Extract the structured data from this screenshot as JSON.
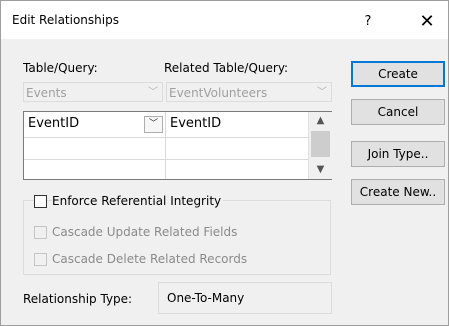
{
  "window": {
    "title": "Edit Relationships",
    "help_glyph": "?",
    "close_glyph": "✕"
  },
  "labels": {
    "table_query": "Table/Query:",
    "related_table_query": "Related Table/Query:"
  },
  "combos": {
    "table": "Events",
    "related_table": "EventVolunteers",
    "arrow_icon": "chevron-down-icon"
  },
  "grid": {
    "rows": [
      {
        "left": "EventID",
        "right": "EventID"
      },
      {
        "left": "",
        "right": ""
      },
      {
        "left": "",
        "right": ""
      }
    ]
  },
  "glyphs": {
    "chevron_down": "﹀",
    "scroll_up": "▲",
    "scroll_down": "▼"
  },
  "buttons": {
    "create": "Create",
    "cancel": "Cancel",
    "join_type": "Join Type..",
    "create_new": "Create New.."
  },
  "checkboxes": {
    "enforce": {
      "label": "Enforce Referential Integrity",
      "checked": false,
      "enabled": true
    },
    "cascade_update": {
      "label": "Cascade Update Related Fields",
      "checked": false,
      "enabled": false
    },
    "cascade_delete": {
      "label": "Cascade Delete Related Records",
      "checked": false,
      "enabled": false
    }
  },
  "relationship": {
    "label": "Relationship Type:",
    "value": "One-To-Many"
  },
  "colors": {
    "default_button_border": "#0078d7",
    "dialog_background": "#f0f0f0"
  }
}
